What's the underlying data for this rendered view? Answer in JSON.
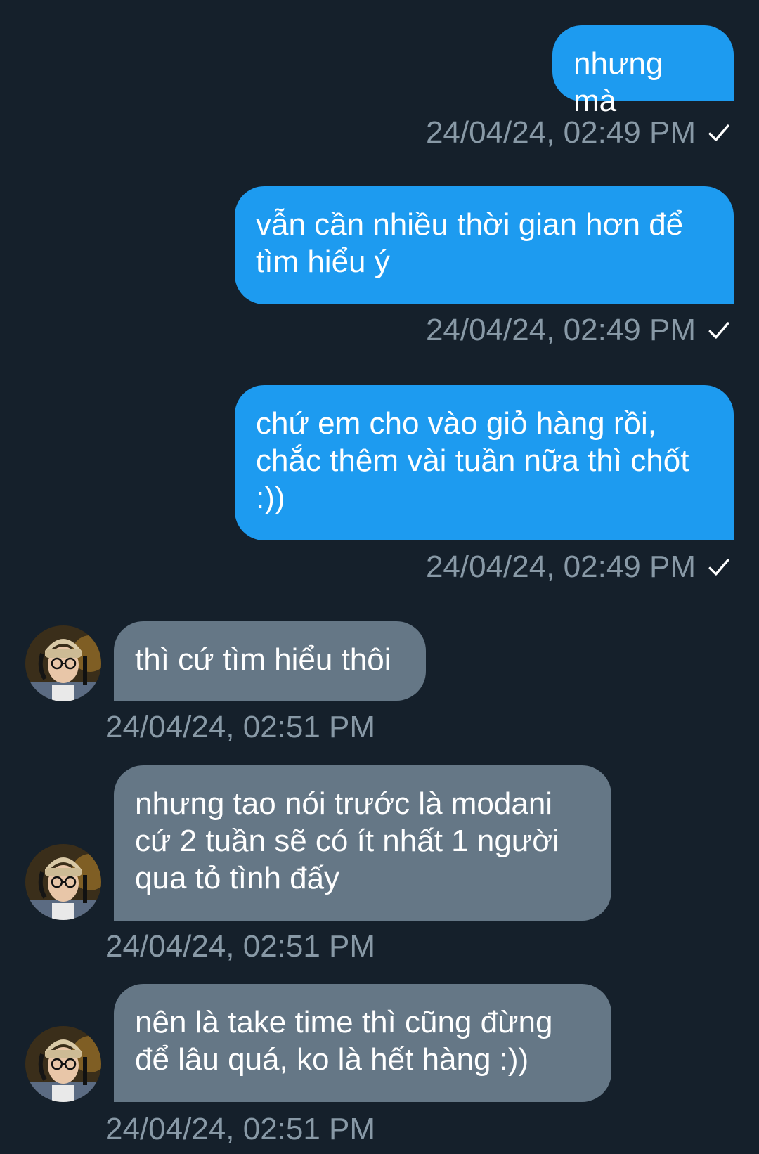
{
  "colors": {
    "background": "#15202b",
    "outgoing_bubble": "#1d9bf0",
    "incoming_bubble": "#657786",
    "timestamp": "#8899a6"
  },
  "messages": [
    {
      "direction": "outgoing",
      "text": "nhưng mà",
      "time": "24/04/24, 02:49 PM",
      "status_icon": "sent-check-icon"
    },
    {
      "direction": "outgoing",
      "text": "vẫn cần nhiều thời gian hơn để tìm hiểu ý",
      "time": "24/04/24, 02:49 PM",
      "status_icon": "sent-check-icon"
    },
    {
      "direction": "outgoing",
      "text": "chứ em cho vào giỏ hàng rồi, chắc thêm vài tuần nữa thì chốt :))",
      "time": "24/04/24, 02:49 PM",
      "status_icon": "sent-check-icon"
    },
    {
      "direction": "incoming",
      "text": "thì cứ tìm hiểu thôi",
      "time": "24/04/24, 02:51 PM"
    },
    {
      "direction": "incoming",
      "text": "nhưng tao nói trước là modani cứ 2 tuần sẽ có ít nhất 1 người qua tỏ tình đấy",
      "time": "24/04/24, 02:51 PM"
    },
    {
      "direction": "incoming",
      "text": "nên là take time thì cũng đừng để lâu quá, ko là hết hàng :))",
      "time": "24/04/24, 02:51 PM"
    }
  ]
}
